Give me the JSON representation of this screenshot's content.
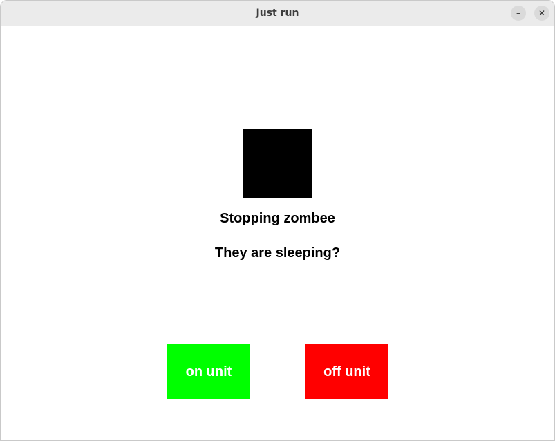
{
  "window": {
    "title": "Just run",
    "minimize_symbol": "–",
    "close_symbol": "✕"
  },
  "main": {
    "indicator_color": "#000000",
    "status_text": "Stopping zombee",
    "question_text": "They are sleeping?"
  },
  "buttons": {
    "on_label": "on unit",
    "on_color": "#00ff00",
    "off_label": "off unit",
    "off_color": "#ff0000"
  }
}
